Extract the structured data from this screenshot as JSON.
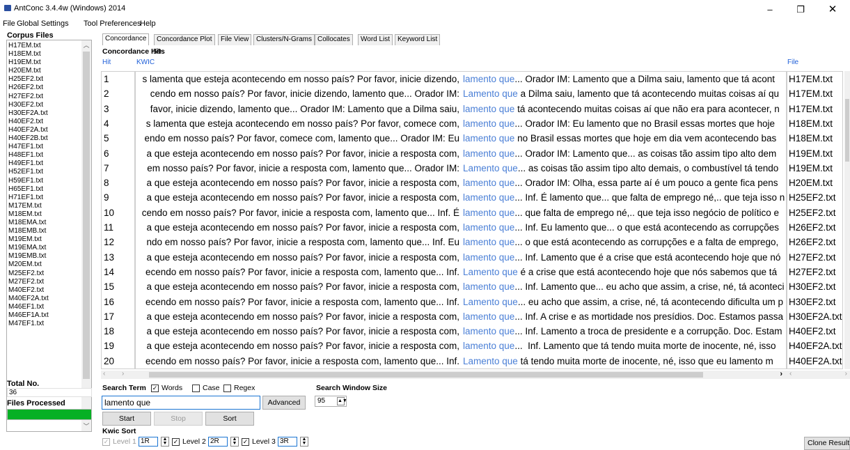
{
  "window": {
    "title": "AntConc 3.4.4w (Windows) 2014",
    "minimize": "–",
    "maximize": "❐",
    "close": "✕"
  },
  "menu": [
    "File",
    "Global Settings",
    "Tool Preferences",
    "Help"
  ],
  "left_panel": {
    "corpus_files_label": "Corpus Files",
    "files": [
      "H17EM.txt",
      "H18EM.txt",
      "H19EM.txt",
      "H20EM.txt",
      "H25EF2.txt",
      "H26EF2.txt",
      "H27EF2.txt",
      "H30EF2.txt",
      "H30EF2A.txt",
      "H40EF2.txt",
      "H40EF2A.txt",
      "H40EF2B.txt",
      "H47EF1.txt",
      "H48EF1.txt",
      "H49EF1.txt",
      "H52EF1.txt",
      "H59EF1.txt",
      "H65EF1.txt",
      "H71EF1.txt",
      "M17EM.txt",
      "M18EM.txt",
      "M18EMA.txt",
      "M18EMB.txt",
      "M19EM.txt",
      "M19EMA.txt",
      "M19EMB.txt",
      "M20EM.txt",
      "M25EF2.txt",
      "M27EF2.txt",
      "M40EF2.txt",
      "M40EF2A.txt",
      "M46EF1.txt",
      "M46EF1A.txt",
      "M47EF1.txt"
    ],
    "total_no_label": "Total No.",
    "total_no_value": "36",
    "files_processed_label": "Files Processed",
    "files_processed_fraction": 1.0
  },
  "tabs": [
    "Concordance",
    "Concordance Plot",
    "File View",
    "Clusters/N-Grams",
    "Collocates",
    "Word List",
    "Keyword List"
  ],
  "active_tab": "Concordance",
  "concordance": {
    "hits_label": "Concordance Hits",
    "hits_count": "59",
    "headers": {
      "hit": "Hit",
      "kwic": "KWIC",
      "file": "File"
    },
    "rows": [
      {
        "hit": "1",
        "left": "s lamenta que esteja acontecendo em nosso país? Por favor, inicie dizendo,",
        "key": "lamento que",
        "right": "... Orador IM: Lamento que a Dilma saiu, lamento que tá acont",
        "file": "H17EM.txt"
      },
      {
        "hit": "2",
        "left": "cendo em nosso país? Por favor, inicie dizendo, lamento que... Orador IM:",
        "key": "Lamento que",
        "right": " a Dilma saiu, lamento que tá acontecendo muitas coisas aí qu",
        "file": "H17EM.txt"
      },
      {
        "hit": "3",
        "left": "favor, inicie dizendo, lamento que... Orador IM: Lamento que a Dilma saiu,",
        "key": "lamento que",
        "right": " tá acontecendo muitas coisas aí que não era para acontecer, n",
        "file": "H17EM.txt"
      },
      {
        "hit": "4",
        "left": "s lamenta que esteja acontecendo em nosso país? Por favor, comece com,",
        "key": "lamento que",
        "right": "... Orador IM: Eu lamento que no Brasil essas mortes que hoje",
        "file": "H18EM.txt"
      },
      {
        "hit": "5",
        "left": "endo em nosso país? Por favor, comece com, lamento que... Orador IM: Eu",
        "key": "lamento que",
        "right": " no Brasil essas mortes que hoje em dia vem acontecendo bas",
        "file": "H18EM.txt"
      },
      {
        "hit": "6",
        "left": "a que esteja acontecendo em nosso país? Por favor, inicie a resposta com,",
        "key": "lamento que",
        "right": "... Orador IM: Lamento que... as coisas tão assim tipo alto dem",
        "file": "H19EM.txt"
      },
      {
        "hit": "7",
        "left": "em nosso país? Por favor, inicie a resposta com, lamento que... Orador IM:",
        "key": "Lamento que",
        "right": "... as coisas tão assim tipo alto demais, o combustível tá tendo",
        "file": "H19EM.txt"
      },
      {
        "hit": "8",
        "left": "a que esteja acontecendo em nosso país? Por favor, inicie a resposta com,",
        "key": "lamento que",
        "right": "... Orador IM: Olha, essa parte aí é um pouco a gente fica pens",
        "file": "H20EM.txt"
      },
      {
        "hit": "9",
        "left": "a que esteja acontecendo em nosso país? Por favor, inicie a resposta com,",
        "key": "lamento que",
        "right": "... Inf. É lamento que... que falta de emprego né,.. que teja isso n",
        "file": "H25EF2.txt"
      },
      {
        "hit": "10",
        "left": "cendo em nosso país? Por favor, inicie a resposta com, lamento que... Inf. É",
        "key": "lamento que",
        "right": "... que falta de emprego né,.. que teja isso negócio de político e",
        "file": "H25EF2.txt"
      },
      {
        "hit": "11",
        "left": "a que esteja acontecendo em nosso país? Por favor, inicie a resposta com,",
        "key": "lamento que",
        "right": "... Inf. Eu lamento que... o que está acontecendo as corrupções",
        "file": "H26EF2.txt"
      },
      {
        "hit": "12",
        "left": "ndo em nosso país? Por favor, inicie a resposta com, lamento que... Inf. Eu",
        "key": "lamento que",
        "right": "... o que está acontecendo as corrupções e a falta de emprego,",
        "file": "H26EF2.txt"
      },
      {
        "hit": "13",
        "left": "a que esteja acontecendo em nosso país? Por favor, inicie a resposta com,",
        "key": "lamento que",
        "right": "... Inf. Lamento que é a crise que está acontecendo hoje que nó",
        "file": "H27EF2.txt"
      },
      {
        "hit": "14",
        "left": "ecendo em nosso país? Por favor, inicie a resposta com, lamento que... Inf.",
        "key": "Lamento que",
        "right": " é a crise que está acontecendo hoje que nós sabemos que tá",
        "file": "H27EF2.txt"
      },
      {
        "hit": "15",
        "left": "a que esteja acontecendo em nosso país? Por favor, inicie a resposta com,",
        "key": "lamento que",
        "right": "... Inf. Lamento que... eu acho que assim, a crise, né, tá aconteci",
        "file": "H30EF2.txt"
      },
      {
        "hit": "16",
        "left": "ecendo em nosso país? Por favor, inicie a resposta com, lamento que... Inf.",
        "key": "Lamento que",
        "right": "... eu acho que assim, a crise, né, tá acontecendo dificulta um p",
        "file": "H30EF2.txt"
      },
      {
        "hit": "17",
        "left": "a que esteja acontecendo em nosso país? Por favor, inicie a resposta com,",
        "key": "lamento que",
        "right": "... Inf. A crise e as mortidade nos presídios. Doc. Estamos passa",
        "file": "H30EF2A.txt"
      },
      {
        "hit": "18",
        "left": "a que esteja acontecendo em nosso país? Por favor, inicie a resposta com,",
        "key": "lamento que",
        "right": "... Inf. Lamento a troca de presidente e a corrupção. Doc. Estam",
        "file": "H40EF2.txt"
      },
      {
        "hit": "19",
        "left": "a que esteja acontecendo em nosso país? Por favor, inicie a resposta com,",
        "key": "lamento que",
        "right": "...  Inf. Lamento que tá tendo muita morte de inocente, né, isso",
        "file": "H40EF2A.txt"
      },
      {
        "hit": "20",
        "left": "ecendo em nosso país? Por favor, inicie a resposta com, lamento que...  Inf.",
        "key": "Lamento que",
        "right": " tá tendo muita morte de inocente, né, isso que eu lamento m",
        "file": "H40EF2A.txt"
      }
    ]
  },
  "search": {
    "term_label": "Search Term",
    "words_label": "Words",
    "case_label": "Case",
    "regex_label": "Regex",
    "words_checked": true,
    "case_checked": false,
    "regex_checked": false,
    "value": "lamento que",
    "advanced_label": "Advanced",
    "window_size_label": "Search Window Size",
    "window_size_value": "95",
    "start_label": "Start",
    "stop_label": "Stop",
    "sort_label": "Sort"
  },
  "kwic_sort": {
    "label": "Kwic Sort",
    "levels": [
      {
        "label": "Level 1",
        "value": "1R",
        "checked": true,
        "disabled": true
      },
      {
        "label": "Level 2",
        "value": "2R",
        "checked": true,
        "disabled": false
      },
      {
        "label": "Level 3",
        "value": "3R",
        "checked": true,
        "disabled": false
      }
    ]
  },
  "clone_results_label": "Clone Results"
}
